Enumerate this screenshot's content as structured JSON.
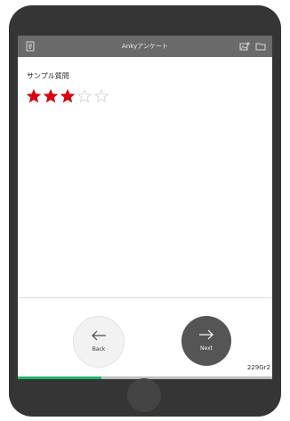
{
  "app": {
    "title": "Ankyアンケート"
  },
  "topbar": {
    "left_icon": "document-list-icon",
    "right_icons": [
      "image-add-icon",
      "folder-icon"
    ]
  },
  "question": {
    "label": "サンプル質問",
    "rating": 3,
    "max_rating": 5,
    "filled_color": "#d8000f",
    "empty_color": "#d9d9d9"
  },
  "navigation": {
    "back_label": "Back",
    "next_label": "Next",
    "back_icon": "arrow-left-icon",
    "next_icon": "arrow-right-icon"
  },
  "status": {
    "version": "229Gr2",
    "progress_fraction": 0.33,
    "progress_color": "#22b36a",
    "track_color": "#bdbdbd"
  },
  "device": {
    "frame_color": "#353535",
    "topbar_color": "#6a6a6a"
  }
}
